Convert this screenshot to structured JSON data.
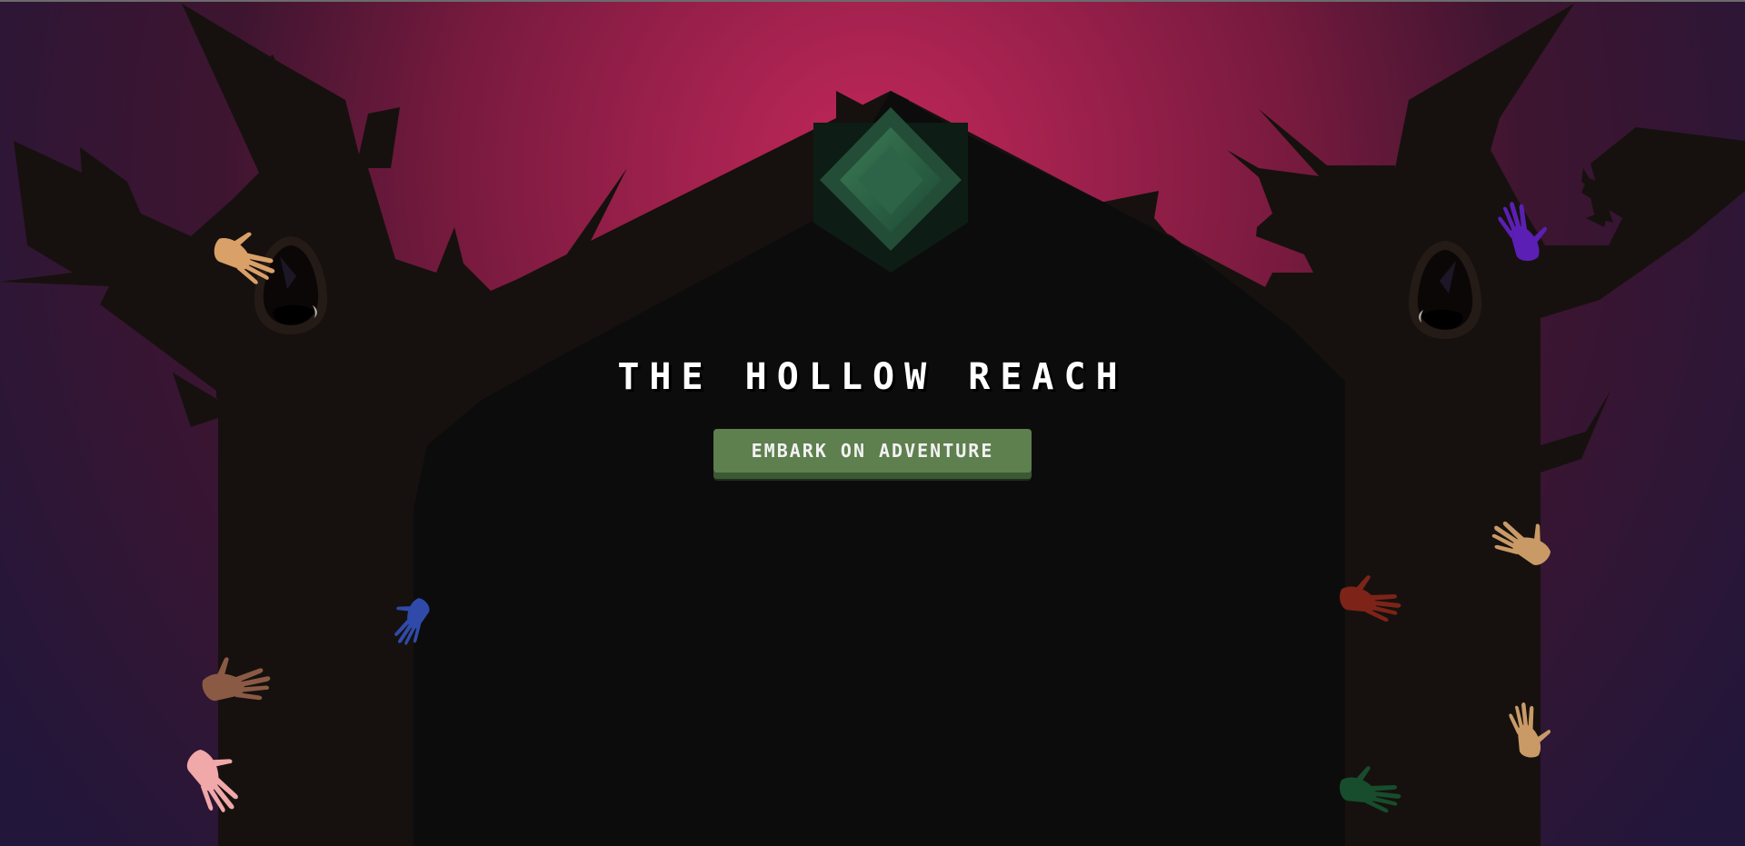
{
  "game": {
    "title": "THE HOLLOW REACH",
    "start_button_label": "EMBARK ON ADVENTURE"
  },
  "colors": {
    "sky_center": "#c2275a",
    "sky_edge": "#22163a",
    "tree_bark": "#16110e",
    "doorway": "#0c0c0d",
    "gem": "#2a5a40",
    "button": "#5e7f4e",
    "button_shadow": "#3b5a33",
    "title_text": "#ffffff"
  },
  "scene": {
    "left_tree_hands": [
      "tan-hand",
      "blue-hand",
      "brown-hand",
      "pink-hand"
    ],
    "right_tree_hands": [
      "purple-hand",
      "tan-hand",
      "red-hand",
      "green-hand",
      "tan-hand"
    ],
    "icons": [
      "knothole-eye-icon",
      "emerald-gem-icon"
    ]
  }
}
